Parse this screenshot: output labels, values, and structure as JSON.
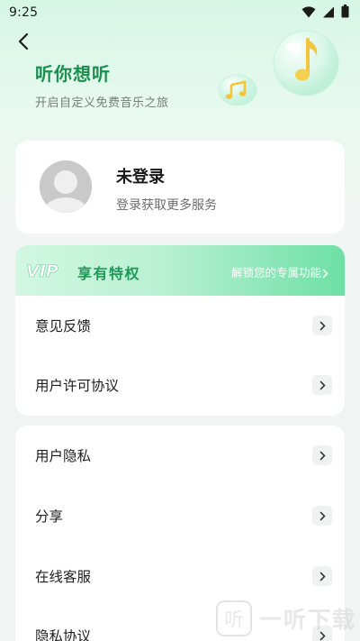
{
  "status_bar": {
    "time": "9:25",
    "icons": [
      "wifi-icon",
      "signal-icon",
      "battery-icon"
    ]
  },
  "header": {
    "back_icon": "back-arrow-icon",
    "title": "听你想听",
    "subtitle": "开启自定义免费音乐之旅"
  },
  "profile": {
    "name": "未登录",
    "description": "登录获取更多服务"
  },
  "vip": {
    "logo_text": "VIP",
    "title": "享有特权",
    "link": "解锁您的专属功能"
  },
  "menu_group_1": [
    {
      "label": "意见反馈"
    },
    {
      "label": "用户许可协议"
    }
  ],
  "menu_group_2": [
    {
      "label": "用户隐私"
    },
    {
      "label": "分享"
    },
    {
      "label": "在线客服"
    },
    {
      "label": "隐私协议"
    }
  ],
  "watermark": {
    "glyph": "听",
    "text": "一听下载"
  },
  "colors": {
    "brand_green": "#1a8f4e",
    "vip_gradient_end": "#6ee0a5",
    "card_bg": "#ffffff"
  }
}
